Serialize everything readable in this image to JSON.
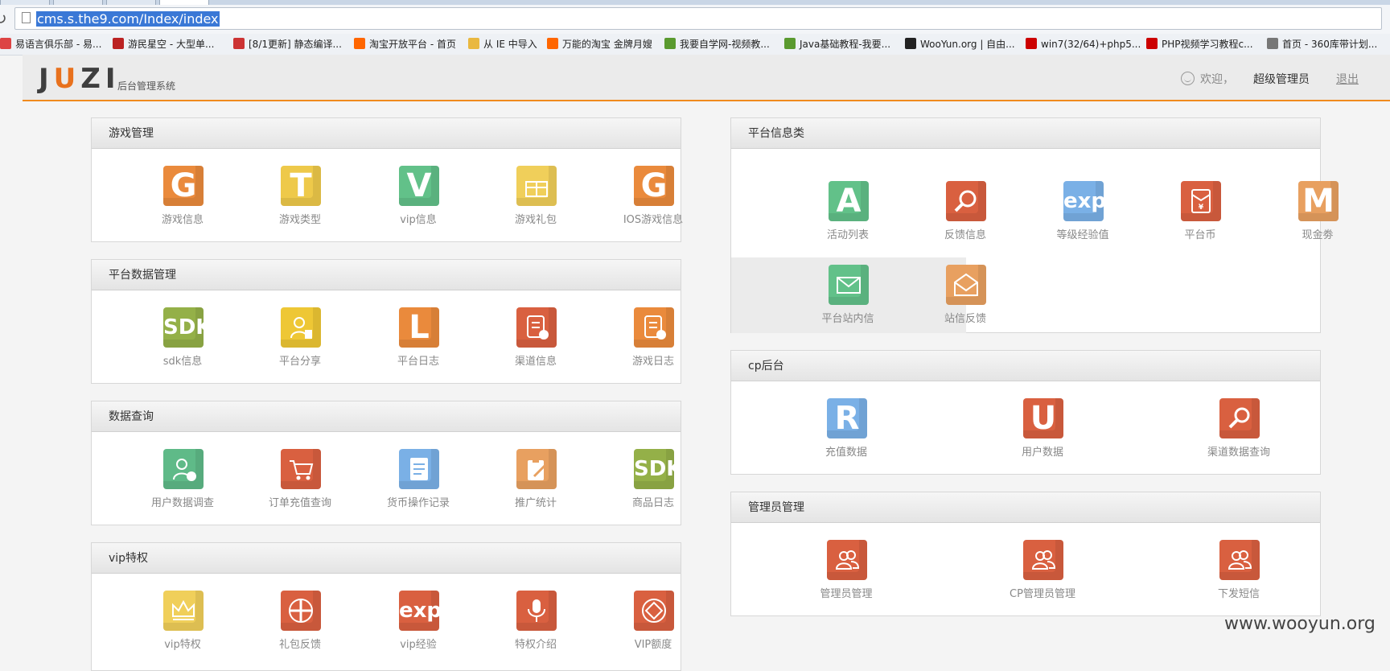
{
  "browser": {
    "url": "cms.s.the9.com/Index/index",
    "bookmarks": [
      {
        "label": "易语言俱乐部 - 易...",
        "color": "#d44"
      },
      {
        "label": "游民星空 - 大型单...",
        "color": "#b22"
      },
      {
        "label": "[8/1更新] 静态编译...",
        "color": "#c33"
      },
      {
        "label": "淘宝开放平台 - 首页",
        "color": "#f60"
      },
      {
        "label": "从 IE 中导入",
        "color": "#e9b840"
      },
      {
        "label": "万能的淘宝 金牌月嫂",
        "color": "#f60"
      },
      {
        "label": "我要自学网-视频教...",
        "color": "#5a9a2f"
      },
      {
        "label": "Java基础教程-我要...",
        "color": "#5a9a2f"
      },
      {
        "label": "WooYun.org | 自由...",
        "color": "#222"
      },
      {
        "label": "win7(32/64)+php5...",
        "color": "#c00"
      },
      {
        "label": "PHP视频学习教程c...",
        "color": "#c00"
      },
      {
        "label": "首页 - 360库带计划...",
        "color": "#777"
      }
    ]
  },
  "header": {
    "logo": "JUZI",
    "subtitle": "后台管理系统",
    "welcome": "欢迎，",
    "user": "超级管理员",
    "logout": "退出"
  },
  "panels": {
    "game": {
      "title": "游戏管理",
      "items": [
        {
          "label": "游戏信息",
          "glyph": "G",
          "color": "#ea8a3c",
          "icon": "letter-g-icon"
        },
        {
          "label": "游戏类型",
          "glyph": "T",
          "color": "#eec94a",
          "icon": "letter-t-icon"
        },
        {
          "label": "vip信息",
          "glyph": "V",
          "color": "#62c189",
          "icon": "letter-v-icon"
        },
        {
          "label": "游戏礼包",
          "glyph": "",
          "color": "#f0cf5a",
          "icon": "gift-icon"
        },
        {
          "label": "IOS游戏信息",
          "glyph": "G",
          "color": "#ea8a3c",
          "icon": "letter-g-icon"
        }
      ]
    },
    "platform_data": {
      "title": "平台数据管理",
      "items": [
        {
          "label": "sdk信息",
          "glyph": "SDK",
          "color": "#94b048",
          "icon": "sdk-icon"
        },
        {
          "label": "平台分享",
          "glyph": "",
          "color": "#eec735",
          "icon": "user-doc-icon"
        },
        {
          "label": "平台日志",
          "glyph": "L",
          "color": "#ea8a3c",
          "icon": "letter-l-icon"
        },
        {
          "label": "渠道信息",
          "glyph": "",
          "color": "#d96040",
          "icon": "doc-plus-icon"
        },
        {
          "label": "游戏日志",
          "glyph": "",
          "color": "#ea8a3c",
          "icon": "doc-plus-icon"
        }
      ]
    },
    "data_query": {
      "title": "数据查询",
      "items": [
        {
          "label": "用户数据调查",
          "glyph": "",
          "color": "#5fba88",
          "icon": "user-add-icon"
        },
        {
          "label": "订单充值查询",
          "glyph": "",
          "color": "#d96040",
          "icon": "cart-icon"
        },
        {
          "label": "货币操作记录",
          "glyph": "",
          "color": "#7ab0e6",
          "icon": "document-icon"
        },
        {
          "label": "推广统计",
          "glyph": "",
          "color": "#e8a060",
          "icon": "clipboard-pen-icon"
        },
        {
          "label": "商品日志",
          "glyph": "SDK",
          "color": "#94b048",
          "icon": "sdk-icon"
        }
      ]
    },
    "vip": {
      "title": "vip特权",
      "items": [
        {
          "label": "vip特权",
          "glyph": "",
          "color": "#f0cf5a",
          "icon": "crown-icon"
        },
        {
          "label": "礼包反馈",
          "glyph": "",
          "color": "#d96040",
          "icon": "gift-box-icon"
        },
        {
          "label": "vip经验",
          "glyph": "exp",
          "color": "#d96040",
          "icon": "exp-icon"
        },
        {
          "label": "特权介绍",
          "glyph": "",
          "color": "#d96040",
          "icon": "microphone-icon"
        },
        {
          "label": "VIP额度",
          "glyph": "",
          "color": "#d96040",
          "icon": "coin-icon"
        }
      ]
    },
    "platform_info": {
      "title": "平台信息类",
      "items": [
        {
          "label": "活动列表",
          "glyph": "A",
          "color": "#62c189",
          "icon": "letter-a-icon"
        },
        {
          "label": "反馈信息",
          "glyph": "",
          "color": "#d96040",
          "icon": "magnifier-icon"
        },
        {
          "label": "等级经验值",
          "glyph": "exp",
          "color": "#7ab0e6",
          "icon": "exp-icon"
        },
        {
          "label": "平台币",
          "glyph": "",
          "color": "#d96040",
          "icon": "red-envelope-icon"
        },
        {
          "label": "现金劵",
          "glyph": "M",
          "color": "#e8a060",
          "icon": "letter-m-icon"
        },
        {
          "label": "平台站内信",
          "glyph": "",
          "color": "#62c189",
          "icon": "envelope-icon"
        },
        {
          "label": "站信反馈",
          "glyph": "",
          "color": "#e8a060",
          "icon": "open-envelope-icon"
        }
      ]
    },
    "cp": {
      "title": "cp后台",
      "items": [
        {
          "label": "充值数据",
          "glyph": "R",
          "color": "#7ab0e6",
          "icon": "letter-r-icon"
        },
        {
          "label": "用户数据",
          "glyph": "U",
          "color": "#d96040",
          "icon": "letter-u-icon"
        },
        {
          "label": "渠道数据查询",
          "glyph": "",
          "color": "#d96040",
          "icon": "search-icon"
        }
      ]
    },
    "admin": {
      "title": "管理员管理",
      "items": [
        {
          "label": "管理员管理",
          "glyph": "",
          "color": "#d96040",
          "icon": "users-icon"
        },
        {
          "label": "CP管理员管理",
          "glyph": "",
          "color": "#d96040",
          "icon": "users-icon"
        },
        {
          "label": "下发短信",
          "glyph": "",
          "color": "#d96040",
          "icon": "users-icon"
        }
      ]
    }
  },
  "watermark": "www.wooyun.org"
}
